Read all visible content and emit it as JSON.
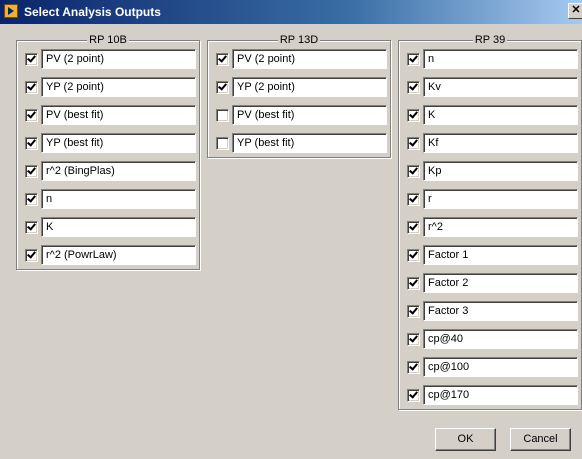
{
  "window": {
    "title": "Select Analysis Outputs",
    "close_glyph": "✕"
  },
  "groups": [
    {
      "title": "RP 10B",
      "items": [
        {
          "label": "PV (2 point)",
          "checked": true
        },
        {
          "label": "YP (2 point)",
          "checked": true
        },
        {
          "label": "PV (best fit)",
          "checked": true
        },
        {
          "label": "YP (best fit)",
          "checked": true
        },
        {
          "label": "r^2 (BingPlas)",
          "checked": true
        },
        {
          "label": "n",
          "checked": true
        },
        {
          "label": "K",
          "checked": true
        },
        {
          "label": "r^2 (PowrLaw)",
          "checked": true
        }
      ]
    },
    {
      "title": "RP 13D",
      "items": [
        {
          "label": "PV (2 point)",
          "checked": true
        },
        {
          "label": "YP (2 point)",
          "checked": true
        },
        {
          "label": "PV (best fit)",
          "checked": false
        },
        {
          "label": "YP (best fit)",
          "checked": false
        }
      ]
    },
    {
      "title": "RP 39",
      "items": [
        {
          "label": "n",
          "checked": true
        },
        {
          "label": "Kv",
          "checked": true
        },
        {
          "label": "K",
          "checked": true
        },
        {
          "label": "Kf",
          "checked": true
        },
        {
          "label": "Kp",
          "checked": true
        },
        {
          "label": "r",
          "checked": true
        },
        {
          "label": "r^2",
          "checked": true
        },
        {
          "label": "Factor 1",
          "checked": true
        },
        {
          "label": "Factor 2",
          "checked": true
        },
        {
          "label": "Factor 3",
          "checked": true
        },
        {
          "label": "cp@40",
          "checked": true
        },
        {
          "label": "cp@100",
          "checked": true
        },
        {
          "label": "cp@170",
          "checked": true
        }
      ]
    }
  ],
  "buttons": {
    "ok": "OK",
    "cancel": "Cancel"
  }
}
